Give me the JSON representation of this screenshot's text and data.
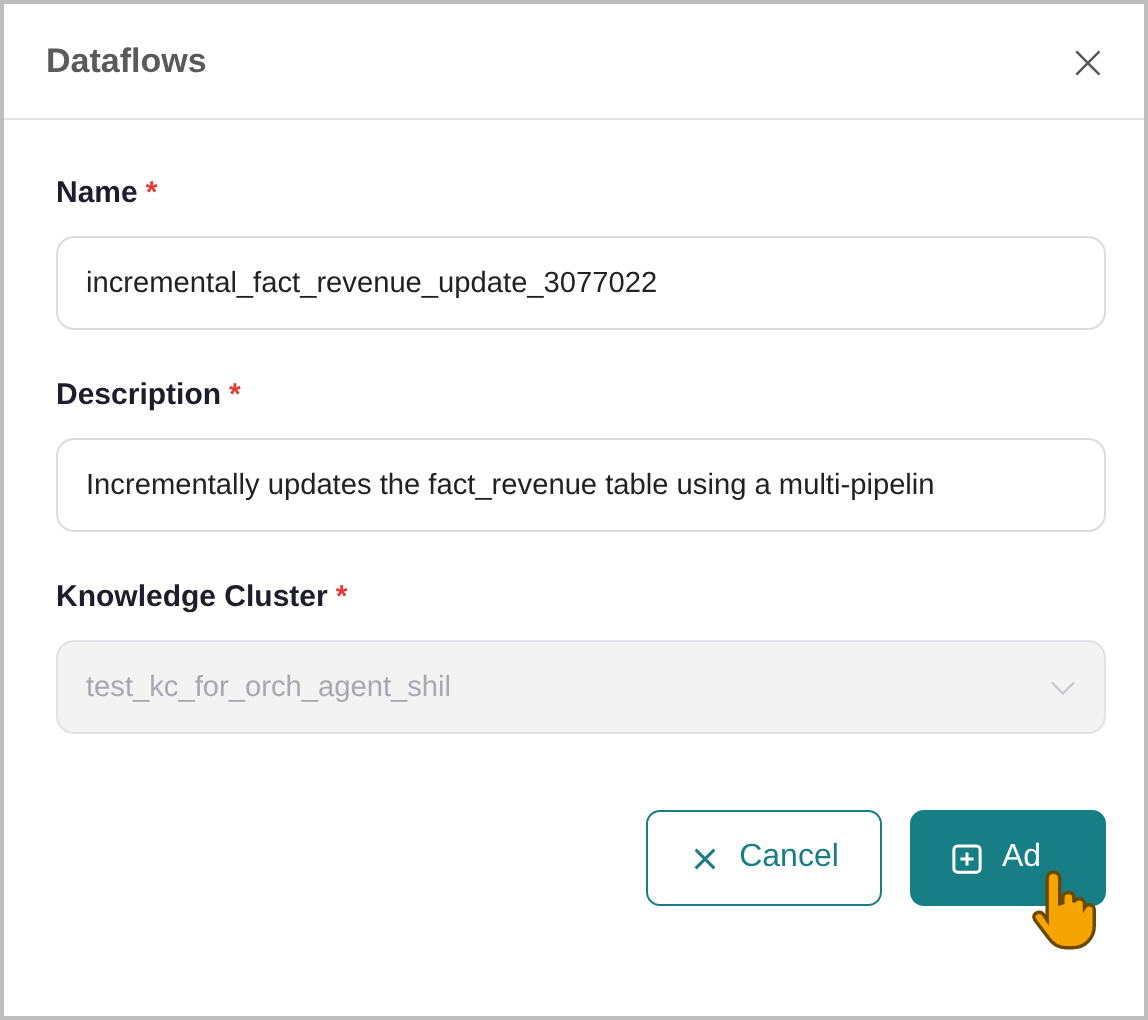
{
  "dialog": {
    "title": "Dataflows",
    "close": "×"
  },
  "fields": [
    {
      "kind": "text",
      "label": "Name",
      "required_mark": "*",
      "value": "incremental_fact_revenue_update_3077022",
      "disabled": false
    },
    {
      "kind": "text",
      "label": "Description",
      "required_mark": "*",
      "value": "Incrementally updates the fact_revenue table using a multi-pipelin",
      "disabled": false
    },
    {
      "kind": "select",
      "label": "Knowledge Cluster",
      "required_mark": "*",
      "value": "test_kc_for_orch_agent_shil",
      "disabled": true
    }
  ],
  "buttons": [
    {
      "kind": "secondary",
      "label": "Cancel"
    },
    {
      "kind": "primary",
      "label": "Ad"
    }
  ]
}
